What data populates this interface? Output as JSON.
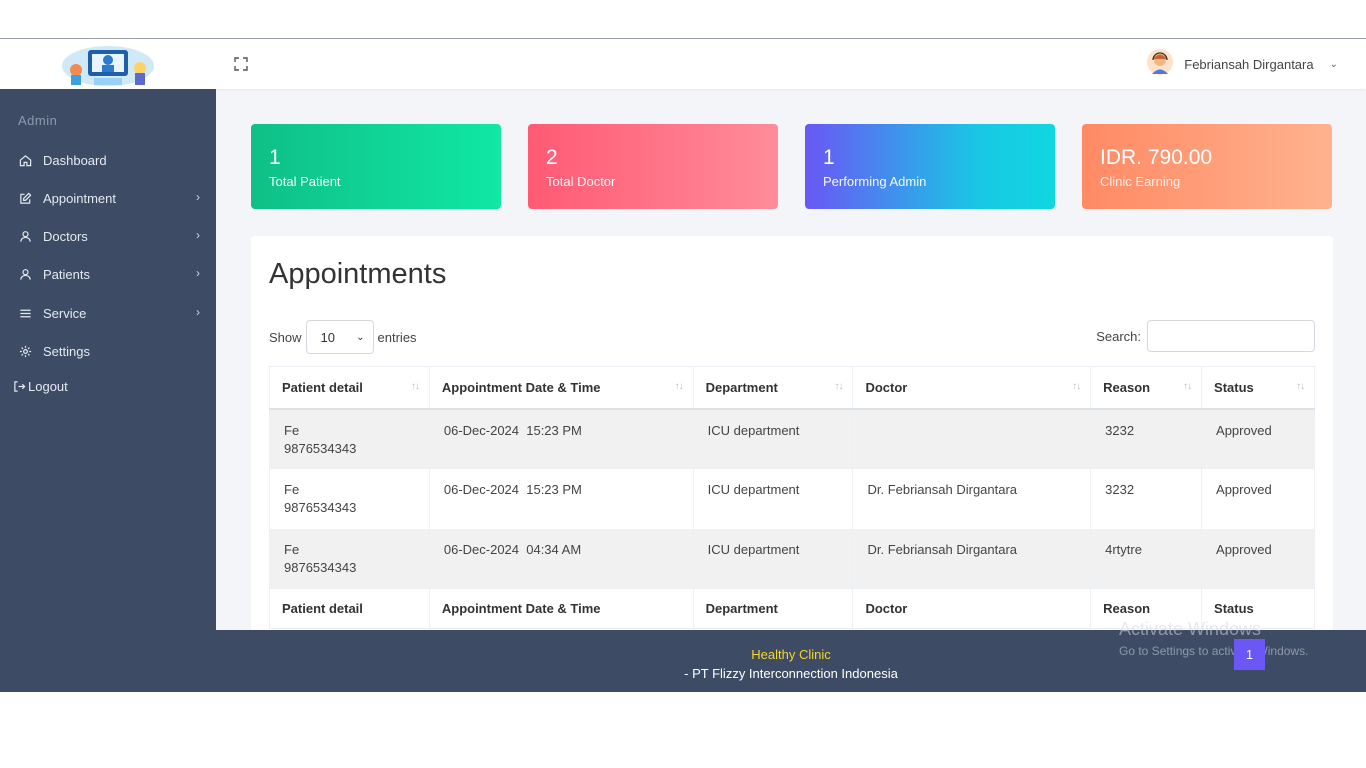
{
  "topbar": {
    "user_name": "Febriansah Dirgantara"
  },
  "sidebar": {
    "section": "Admin",
    "items": [
      {
        "label": "Dashboard",
        "icon": "home-icon"
      },
      {
        "label": "Appointment",
        "icon": "edit-icon"
      },
      {
        "label": "Doctors",
        "icon": "user-icon"
      },
      {
        "label": "Patients",
        "icon": "user-icon"
      },
      {
        "label": "Service",
        "icon": "menu-icon"
      },
      {
        "label": "Settings",
        "icon": "gear-icon"
      }
    ],
    "logout": "Logout"
  },
  "cards": [
    {
      "value": "1",
      "label": "Total Patient"
    },
    {
      "value": "2",
      "label": "Total Doctor"
    },
    {
      "value": "1",
      "label": "Performing Admin"
    },
    {
      "value": "IDR. 790.00",
      "label": "Clinic Earning"
    }
  ],
  "appointments": {
    "title": "Appointments",
    "show_label": "Show",
    "entries_label": "entries",
    "page_size": "10",
    "search_label": "Search:",
    "columns": [
      "Patient detail",
      "Appointment Date & Time",
      "Department",
      "Doctor",
      "Reason",
      "Status"
    ],
    "rows": [
      {
        "name": "Fe",
        "phone": "9876534343",
        "datetime": "06-Dec-2024  15:23 PM",
        "department": "ICU department",
        "doctor": "",
        "reason": "3232",
        "status": "Approved"
      },
      {
        "name": "Fe",
        "phone": "9876534343",
        "datetime": "06-Dec-2024  15:23 PM",
        "department": "ICU department",
        "doctor": "Dr. Febriansah Dirgantara",
        "reason": "3232",
        "status": "Approved"
      },
      {
        "name": "Fe",
        "phone": "9876534343",
        "datetime": "06-Dec-2024  04:34 AM",
        "department": "ICU department",
        "doctor": "Dr. Febriansah Dirgantara",
        "reason": "4rtytre",
        "status": "Approved"
      }
    ],
    "current_page": "1"
  },
  "footer": {
    "brand": "Healthy Clinic",
    "company": "- PT Flizzy Interconnection Indonesia"
  },
  "watermark": {
    "line1": "Activate Windows",
    "line2": "Go to Settings to activate Windows."
  },
  "colors": {
    "sidebar": "#3d4b64",
    "accent": "#6a57f5",
    "footer_brand": "#f5d623"
  }
}
